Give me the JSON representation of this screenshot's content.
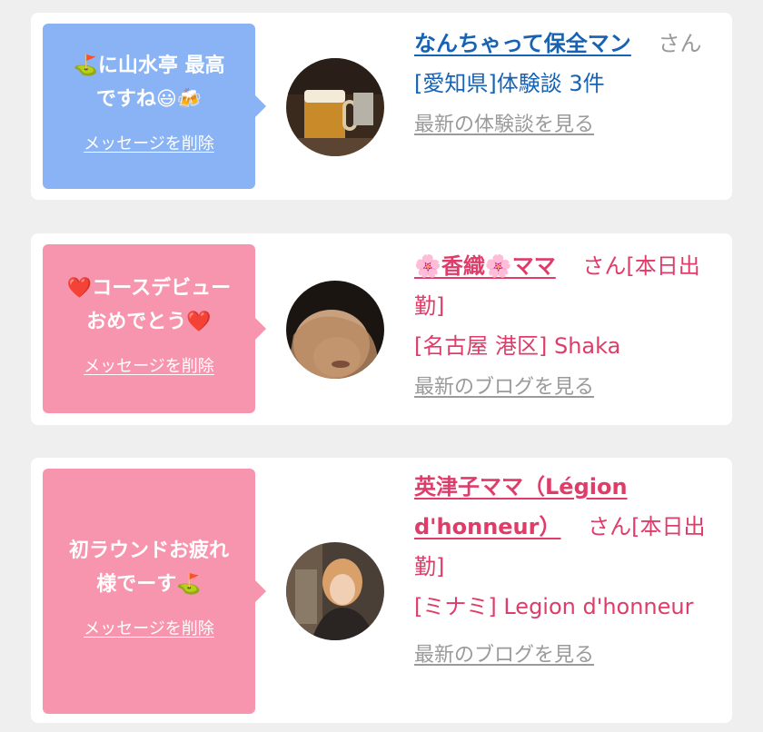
{
  "entries": [
    {
      "message_line1": "⛳に山水亭 最高",
      "message_line2": "ですね😃🍻",
      "delete_label": "メッセージを削除",
      "name": "なんちゃって保全マン",
      "suffix": "さん",
      "area": "[愛知県]体験談 3件",
      "latest_link": "最新の体験談を見る",
      "bubble_color": "#89b3f4",
      "text_color": "#1862b3"
    },
    {
      "message_line1": "❤️コースデビュー",
      "message_line2": "おめでとう❤️",
      "delete_label": "メッセージを削除",
      "name": "🌸香織🌸ママ",
      "suffix": "さん[本日出勤]",
      "area": "[名古屋 港区] Shaka",
      "latest_link": "最新のブログを見る",
      "bubble_color": "#f895ae",
      "text_color": "#df3c6a"
    },
    {
      "message_line1": "初ラウンドお疲れ",
      "message_line2": "様でーす⛳",
      "delete_label": "メッセージを削除",
      "name": "英津子ママ（Légion d'honneur）",
      "suffix": "さん[本日出勤]",
      "area": "[ミナミ] Legion d'honneur",
      "latest_link": "最新のブログを見る",
      "bubble_color": "#f895ae",
      "text_color": "#df3c6a"
    }
  ]
}
